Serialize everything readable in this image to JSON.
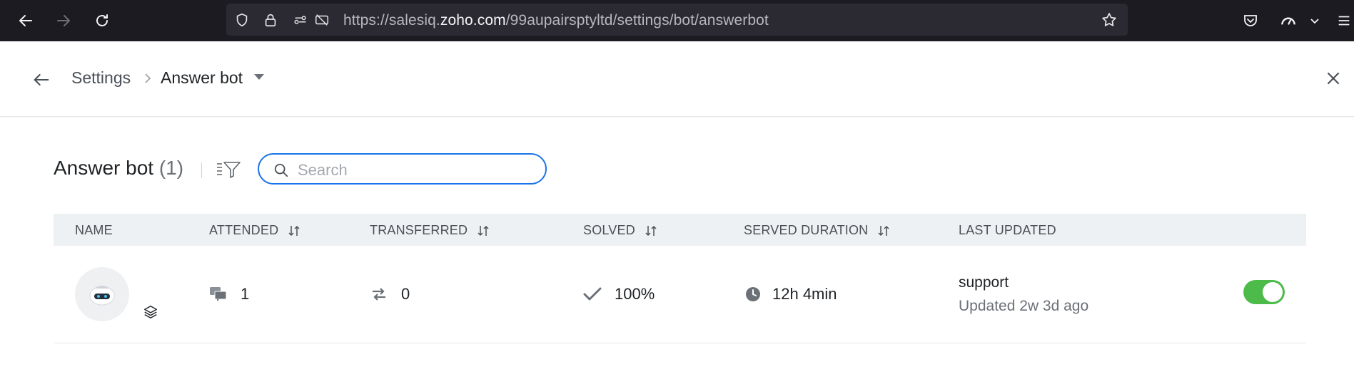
{
  "browser": {
    "url_prefix": "https://salesiq.",
    "url_domain": "zoho.com",
    "url_path": "/99aupairsptyltd/settings/bot/answerbot"
  },
  "header": {
    "breadcrumb_parent": "Settings",
    "breadcrumb_current": "Answer bot"
  },
  "page": {
    "title": "Answer bot",
    "count": "(1)",
    "search_placeholder": "Search"
  },
  "table": {
    "columns": [
      "NAME",
      "ATTENDED",
      "TRANSFERRED",
      "SOLVED",
      "SERVED DURATION",
      "LAST UPDATED"
    ],
    "rows": [
      {
        "attended": "1",
        "transferred": "0",
        "solved": "100%",
        "served_duration": "12h 4min",
        "last_updated_title": "support",
        "last_updated_sub": "Updated 2w 3d ago",
        "enabled": true
      }
    ]
  },
  "colors": {
    "accent": "#1a73e8",
    "toggle_on": "#4cbb4a",
    "chrome_bg": "#1c1b22"
  }
}
